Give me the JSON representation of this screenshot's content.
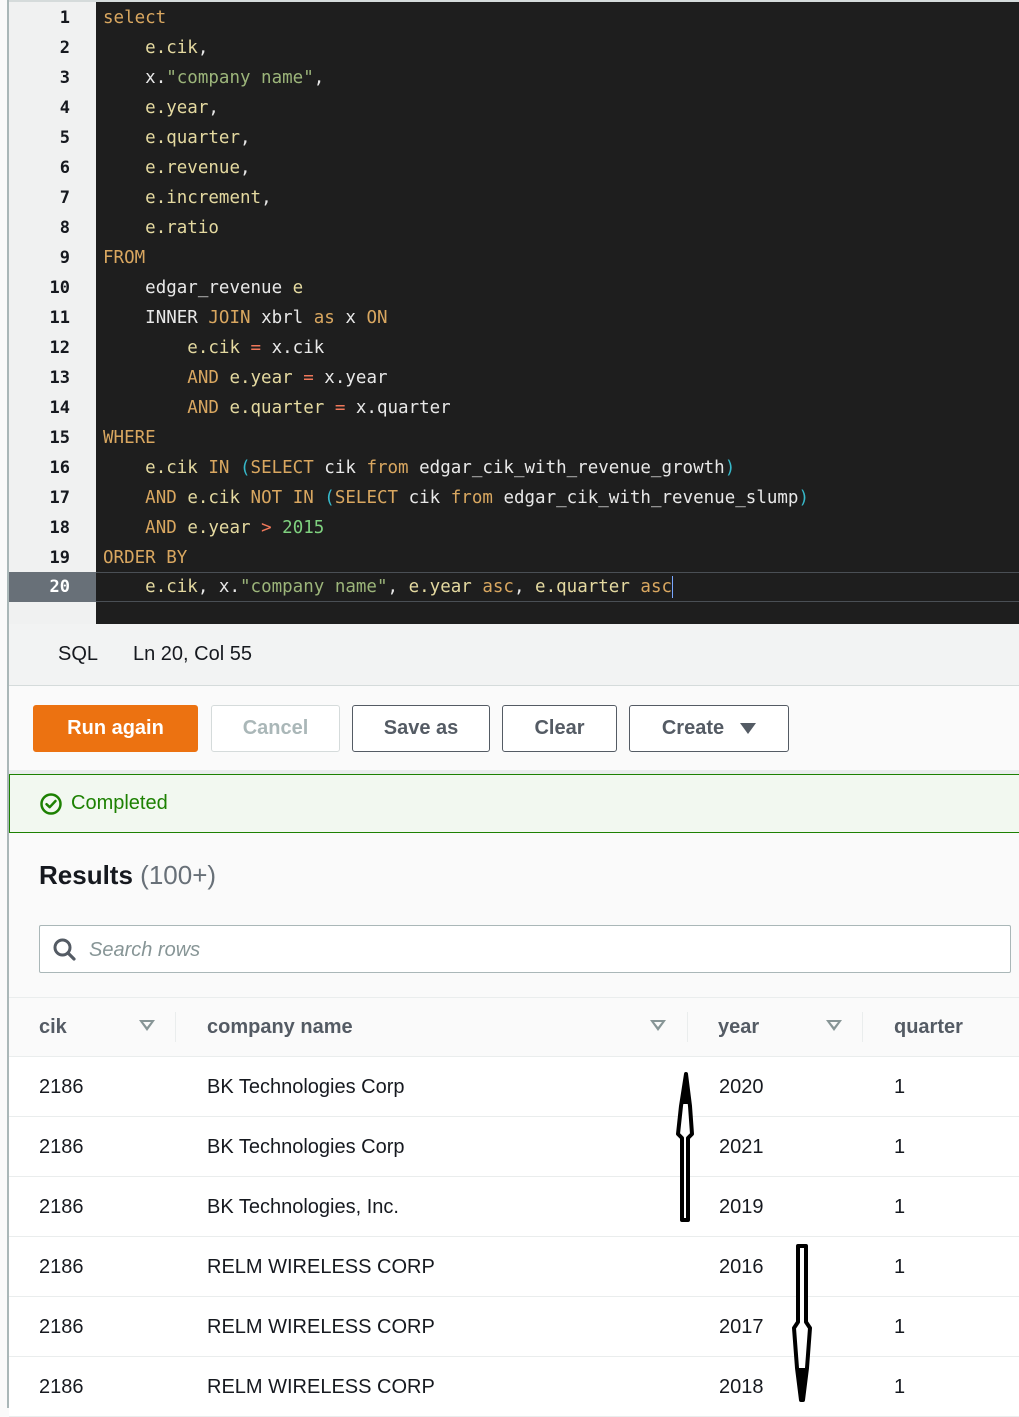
{
  "editor": {
    "lines": [
      {
        "n": "1"
      },
      {
        "n": "2"
      },
      {
        "n": "3"
      },
      {
        "n": "4"
      },
      {
        "n": "5"
      },
      {
        "n": "6"
      },
      {
        "n": "7"
      },
      {
        "n": "8"
      },
      {
        "n": "9"
      },
      {
        "n": "10"
      },
      {
        "n": "11"
      },
      {
        "n": "12"
      },
      {
        "n": "13"
      },
      {
        "n": "14"
      },
      {
        "n": "15"
      },
      {
        "n": "16"
      },
      {
        "n": "17"
      },
      {
        "n": "18"
      },
      {
        "n": "19"
      },
      {
        "n": "20"
      }
    ],
    "active_line": "20",
    "tokens": {
      "l1": [
        "select"
      ],
      "l2": [
        "    ",
        "e.cik",
        ","
      ],
      "l3": [
        "    ",
        "x.",
        "\"company name\"",
        ","
      ],
      "l4": [
        "    ",
        "e.year",
        ","
      ],
      "l5": [
        "    ",
        "e.quarter",
        ","
      ],
      "l6": [
        "    ",
        "e.revenue",
        ","
      ],
      "l7": [
        "    ",
        "e.increment",
        ","
      ],
      "l8": [
        "    ",
        "e.ratio"
      ],
      "l9": [
        "FROM"
      ],
      "l10": [
        "    ",
        "edgar_revenue ",
        "e"
      ],
      "l11": [
        "    ",
        "INNER ",
        "JOIN ",
        "xbrl ",
        "as ",
        "x ",
        "ON"
      ],
      "l12": [
        "        ",
        "e.cik ",
        "= ",
        "x.cik"
      ],
      "l13": [
        "        ",
        "AND ",
        "e.year ",
        "= ",
        "x.year"
      ],
      "l14": [
        "        ",
        "AND ",
        "e.quarter ",
        "= ",
        "x.quarter"
      ],
      "l15": [
        "WHERE"
      ],
      "l16": [
        "    ",
        "e.cik ",
        "IN ",
        "(",
        "SELECT ",
        "cik ",
        "from ",
        "edgar_cik_with_revenue_growth",
        ")"
      ],
      "l17": [
        "    ",
        "AND ",
        "e.cik ",
        "NOT ",
        "IN ",
        "(",
        "SELECT ",
        "cik ",
        "from ",
        "edgar_cik_with_revenue_slump",
        ")"
      ],
      "l18": [
        "    ",
        "AND ",
        "e.year ",
        "> ",
        "2015"
      ],
      "l19": [
        "ORDER BY"
      ],
      "l20": [
        "    ",
        "e.cik",
        ", ",
        "x.",
        "\"company name\"",
        ", ",
        "e.year ",
        "asc",
        ", ",
        "e.quarter ",
        "asc"
      ]
    }
  },
  "statusbar": {
    "language": "SQL",
    "position": "Ln 20, Col 55"
  },
  "toolbar": {
    "run_again": "Run again",
    "cancel": "Cancel",
    "save_as": "Save as",
    "clear": "Clear",
    "create": "Create"
  },
  "status": {
    "label": "Completed",
    "icon": "check-circle-icon",
    "color": "#1d8102"
  },
  "results": {
    "title": "Results",
    "count": "(100+)",
    "search_placeholder": "Search rows",
    "search_value": "",
    "columns": [
      "cik",
      "company name",
      "year",
      "quarter"
    ],
    "rows": [
      {
        "cik": "2186",
        "company": "BK Technologies Corp",
        "year": "2020",
        "quarter": "1"
      },
      {
        "cik": "2186",
        "company": "BK Technologies Corp",
        "year": "2021",
        "quarter": "1"
      },
      {
        "cik": "2186",
        "company": "BK Technologies, Inc.",
        "year": "2019",
        "quarter": "1"
      },
      {
        "cik": "2186",
        "company": "RELM WIRELESS CORP",
        "year": "2016",
        "quarter": "1"
      },
      {
        "cik": "2186",
        "company": "RELM WIRELESS CORP",
        "year": "2017",
        "quarter": "1"
      },
      {
        "cik": "2186",
        "company": "RELM WIRELESS CORP",
        "year": "2018",
        "quarter": "1"
      }
    ]
  },
  "annotations": [
    {
      "type": "up-arrow"
    },
    {
      "type": "down-arrow"
    }
  ],
  "colors": {
    "accent": "#ec7211",
    "success": "#1d8102"
  }
}
